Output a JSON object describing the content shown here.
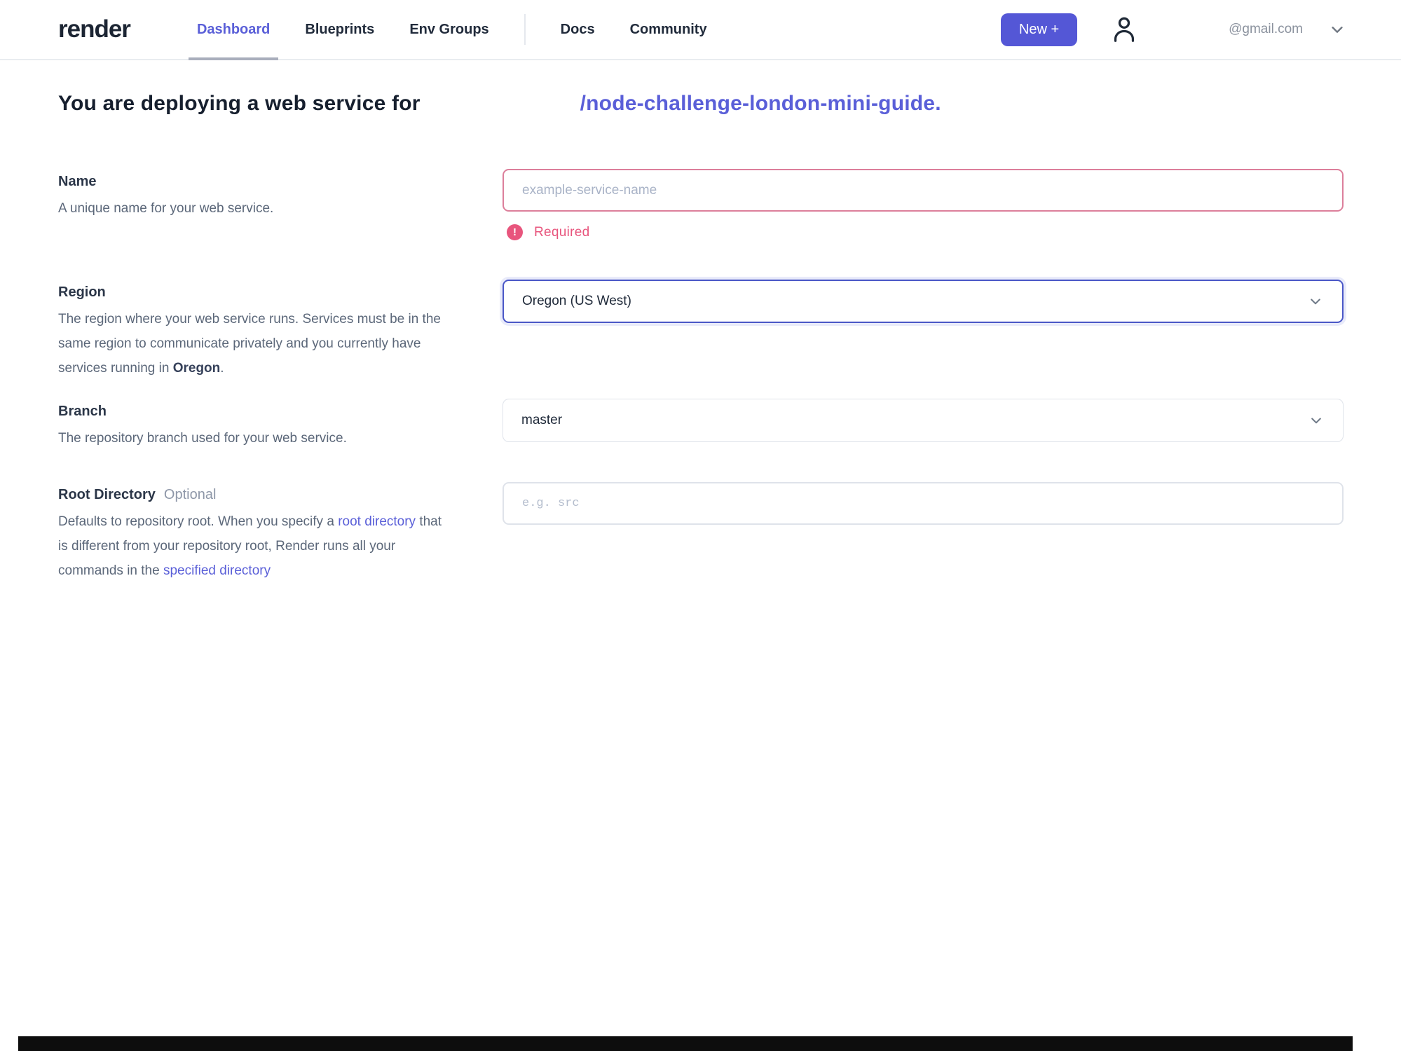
{
  "header": {
    "logo": "render",
    "nav": [
      {
        "label": "Dashboard",
        "active": true
      },
      {
        "label": "Blueprints",
        "active": false
      },
      {
        "label": "Env Groups",
        "active": false
      },
      {
        "label": "Docs",
        "active": false
      },
      {
        "label": "Community",
        "active": false
      }
    ],
    "new_button_label": "New +",
    "account_email": "@gmail.com",
    "icons": {
      "account": "user-outline",
      "account_menu": "chevron-down"
    }
  },
  "heading": {
    "prefix": "You are deploying a web service for",
    "repo": "/node-challenge-london-mini-guide",
    "period": "."
  },
  "form": {
    "name": {
      "label": "Name",
      "description": "A unique name for your web service.",
      "placeholder": "example-service-name",
      "value": "",
      "error": "Required",
      "error_icon": "exclamation-circle"
    },
    "region": {
      "label": "Region",
      "desc_before_bold": "The region where your web service runs. Services must be in the same region to communicate privately and you currently have services running in ",
      "desc_bold": "Oregon",
      "desc_after_bold": ".",
      "selected": "Oregon (US West)",
      "icon": "chevron-down"
    },
    "branch": {
      "label": "Branch",
      "description": "The repository branch used for your web service.",
      "selected": "master",
      "icon": "chevron-down"
    },
    "root_directory": {
      "label": "Root Directory",
      "optional_tag": "Optional",
      "desc_part1": "Defaults to repository root. When you specify a ",
      "desc_link1": "root directory",
      "desc_part2": " that is different from your repository root, Render runs all your commands in the ",
      "desc_link2": "specified directory",
      "placeholder": "e.g. src",
      "value": ""
    }
  },
  "colors": {
    "accent_indigo": "#5a5fd8",
    "button_indigo": "#5457d6",
    "error_pink": "#e8557d",
    "focus_border_blue": "#4a57c7",
    "text_dark": "#212b3b",
    "text_muted": "#5b6779"
  }
}
